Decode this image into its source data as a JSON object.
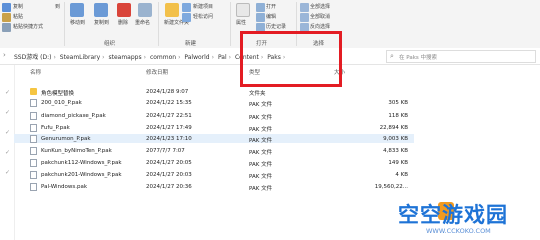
{
  "ribbon": {
    "clipboard_items": [
      "复制",
      "粘贴",
      "粘贴快捷方式"
    ],
    "clipboard_tail": "到",
    "organize_items": [
      "移动到",
      "复制到",
      "删除",
      "重命名"
    ],
    "new_items": [
      "新建项目",
      "轻松访问",
      "新建文件夹"
    ],
    "open_items": [
      "属性",
      "打开",
      "编辑",
      "历史记录"
    ],
    "select_items": [
      "全部选择",
      "全部取消",
      "反向选择"
    ],
    "groups": [
      "组织",
      "新建",
      "打开",
      "选择"
    ]
  },
  "address": {
    "crumbs": [
      "SSD游戏 (D:)",
      "SteamLibrary",
      "steamapps",
      "common",
      "Palworld",
      "Pal",
      "Content",
      "Paks"
    ],
    "search_placeholder": "在 Paks 中搜索"
  },
  "columns": [
    "名称",
    "修改日期",
    "类型",
    "大小"
  ],
  "files": [
    {
      "name": "角色模型替换",
      "date": "2024/1/28 9:07",
      "type": "文件夹",
      "size": "",
      "kind": "folder"
    },
    {
      "name": "200_010_P.pak",
      "date": "2024/1/22 15:35",
      "type": "PAK 文件",
      "size": "305 KB",
      "kind": "file"
    },
    {
      "name": "diamond_pickaxe_P.pak",
      "date": "2024/1/27 22:51",
      "type": "PAK 文件",
      "size": "118 KB",
      "kind": "file"
    },
    {
      "name": "Fufu_P.pak",
      "date": "2024/1/27 17:49",
      "type": "PAK 文件",
      "size": "22,894 KB",
      "kind": "file"
    },
    {
      "name": "Genurumon_P.pak",
      "date": "2024/1/23 17:10",
      "type": "PAK 文件",
      "size": "9,003 KB",
      "kind": "file",
      "selected": true
    },
    {
      "name": "KunKun_byNimoTen_P.pak",
      "date": "2077/7/7 7:07",
      "type": "PAK 文件",
      "size": "4,833 KB",
      "kind": "file"
    },
    {
      "name": "pakchunk112-Windows_P.pak",
      "date": "2024/1/27 20:05",
      "type": "PAK 文件",
      "size": "149 KB",
      "kind": "file"
    },
    {
      "name": "pakchunk201-Windows_P.pak",
      "date": "2024/1/27 20:03",
      "type": "PAK 文件",
      "size": "4 KB",
      "kind": "file"
    },
    {
      "name": "Pal-Windows.pak",
      "date": "2024/1/27 20:36",
      "type": "PAK 文件",
      "size": "19,560,22...",
      "kind": "file"
    }
  ],
  "watermark": {
    "text": "空空游戏园",
    "url": "WWW.CCKOKO.COM"
  }
}
